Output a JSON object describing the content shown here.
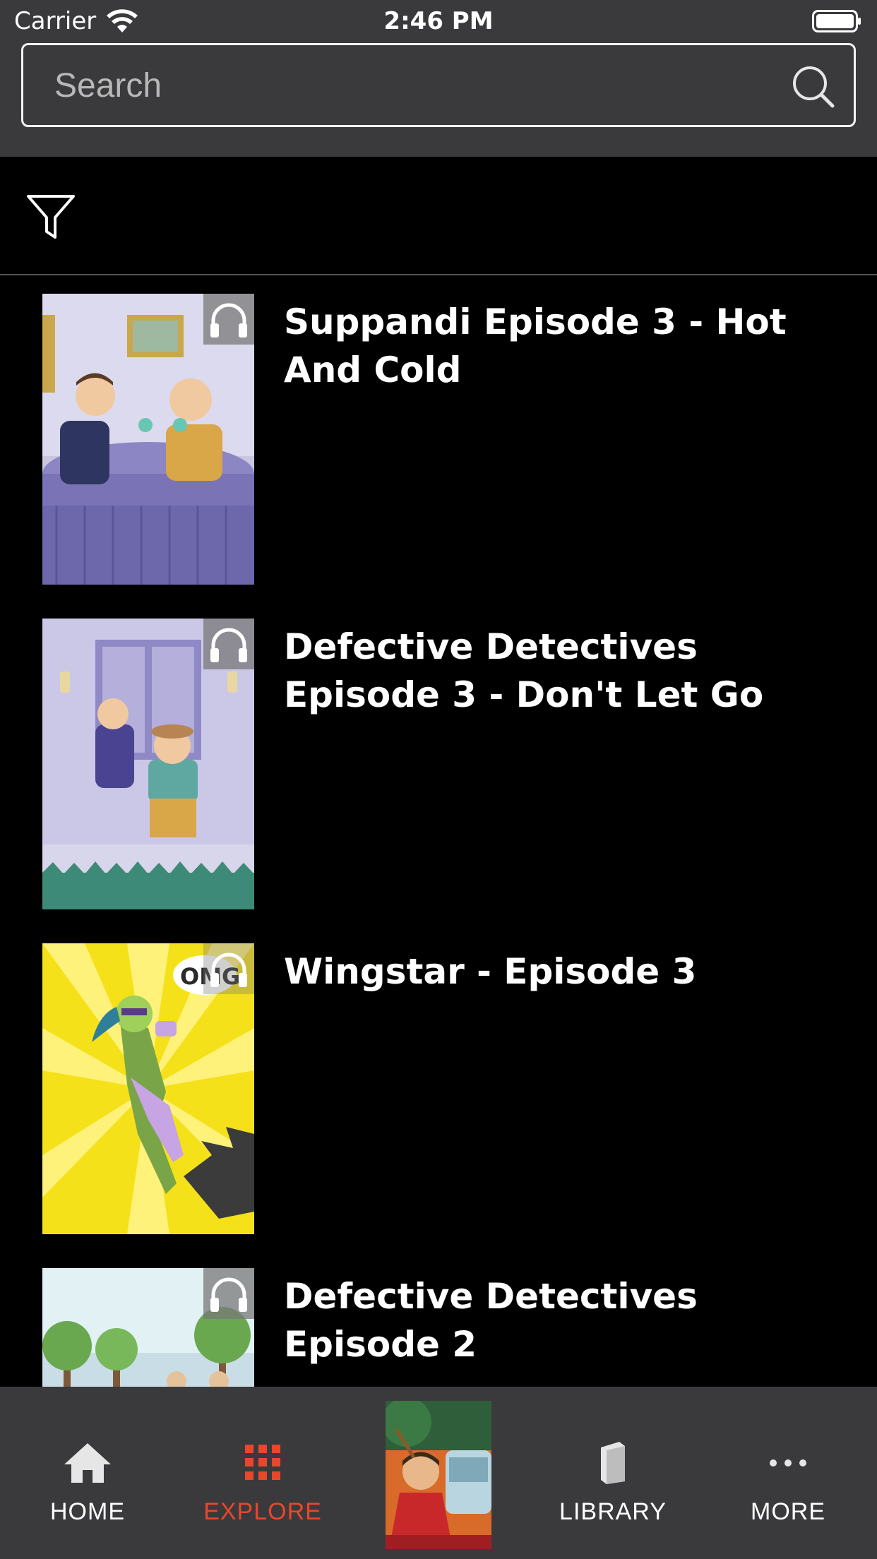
{
  "status_bar": {
    "carrier": "Carrier",
    "time": "2:46 PM"
  },
  "search": {
    "placeholder": "Search",
    "value": ""
  },
  "filter": {
    "icon": "filter-icon"
  },
  "items": [
    {
      "title": "Suppandi Episode 3 - Hot And Cold",
      "badge_icon": "headphones-icon"
    },
    {
      "title": "Defective Detectives Episode 3 - Don't Let Go",
      "badge_icon": "headphones-icon"
    },
    {
      "title": "Wingstar - Episode 3",
      "badge_icon": "headphones-icon"
    },
    {
      "title": "Defective Detectives Episode 2",
      "badge_icon": "headphones-icon"
    }
  ],
  "tabs": [
    {
      "label": "HOME",
      "icon": "home-icon",
      "active": false
    },
    {
      "label": "EXPLORE",
      "icon": "grid-icon",
      "active": true
    },
    {
      "label": "LIBRARY",
      "icon": "book-icon",
      "active": false
    },
    {
      "label": "MORE",
      "icon": "more-icon",
      "active": false
    }
  ],
  "colors": {
    "accent": "#e8472c",
    "header_bg": "#3a3a3c",
    "background": "#000000"
  }
}
